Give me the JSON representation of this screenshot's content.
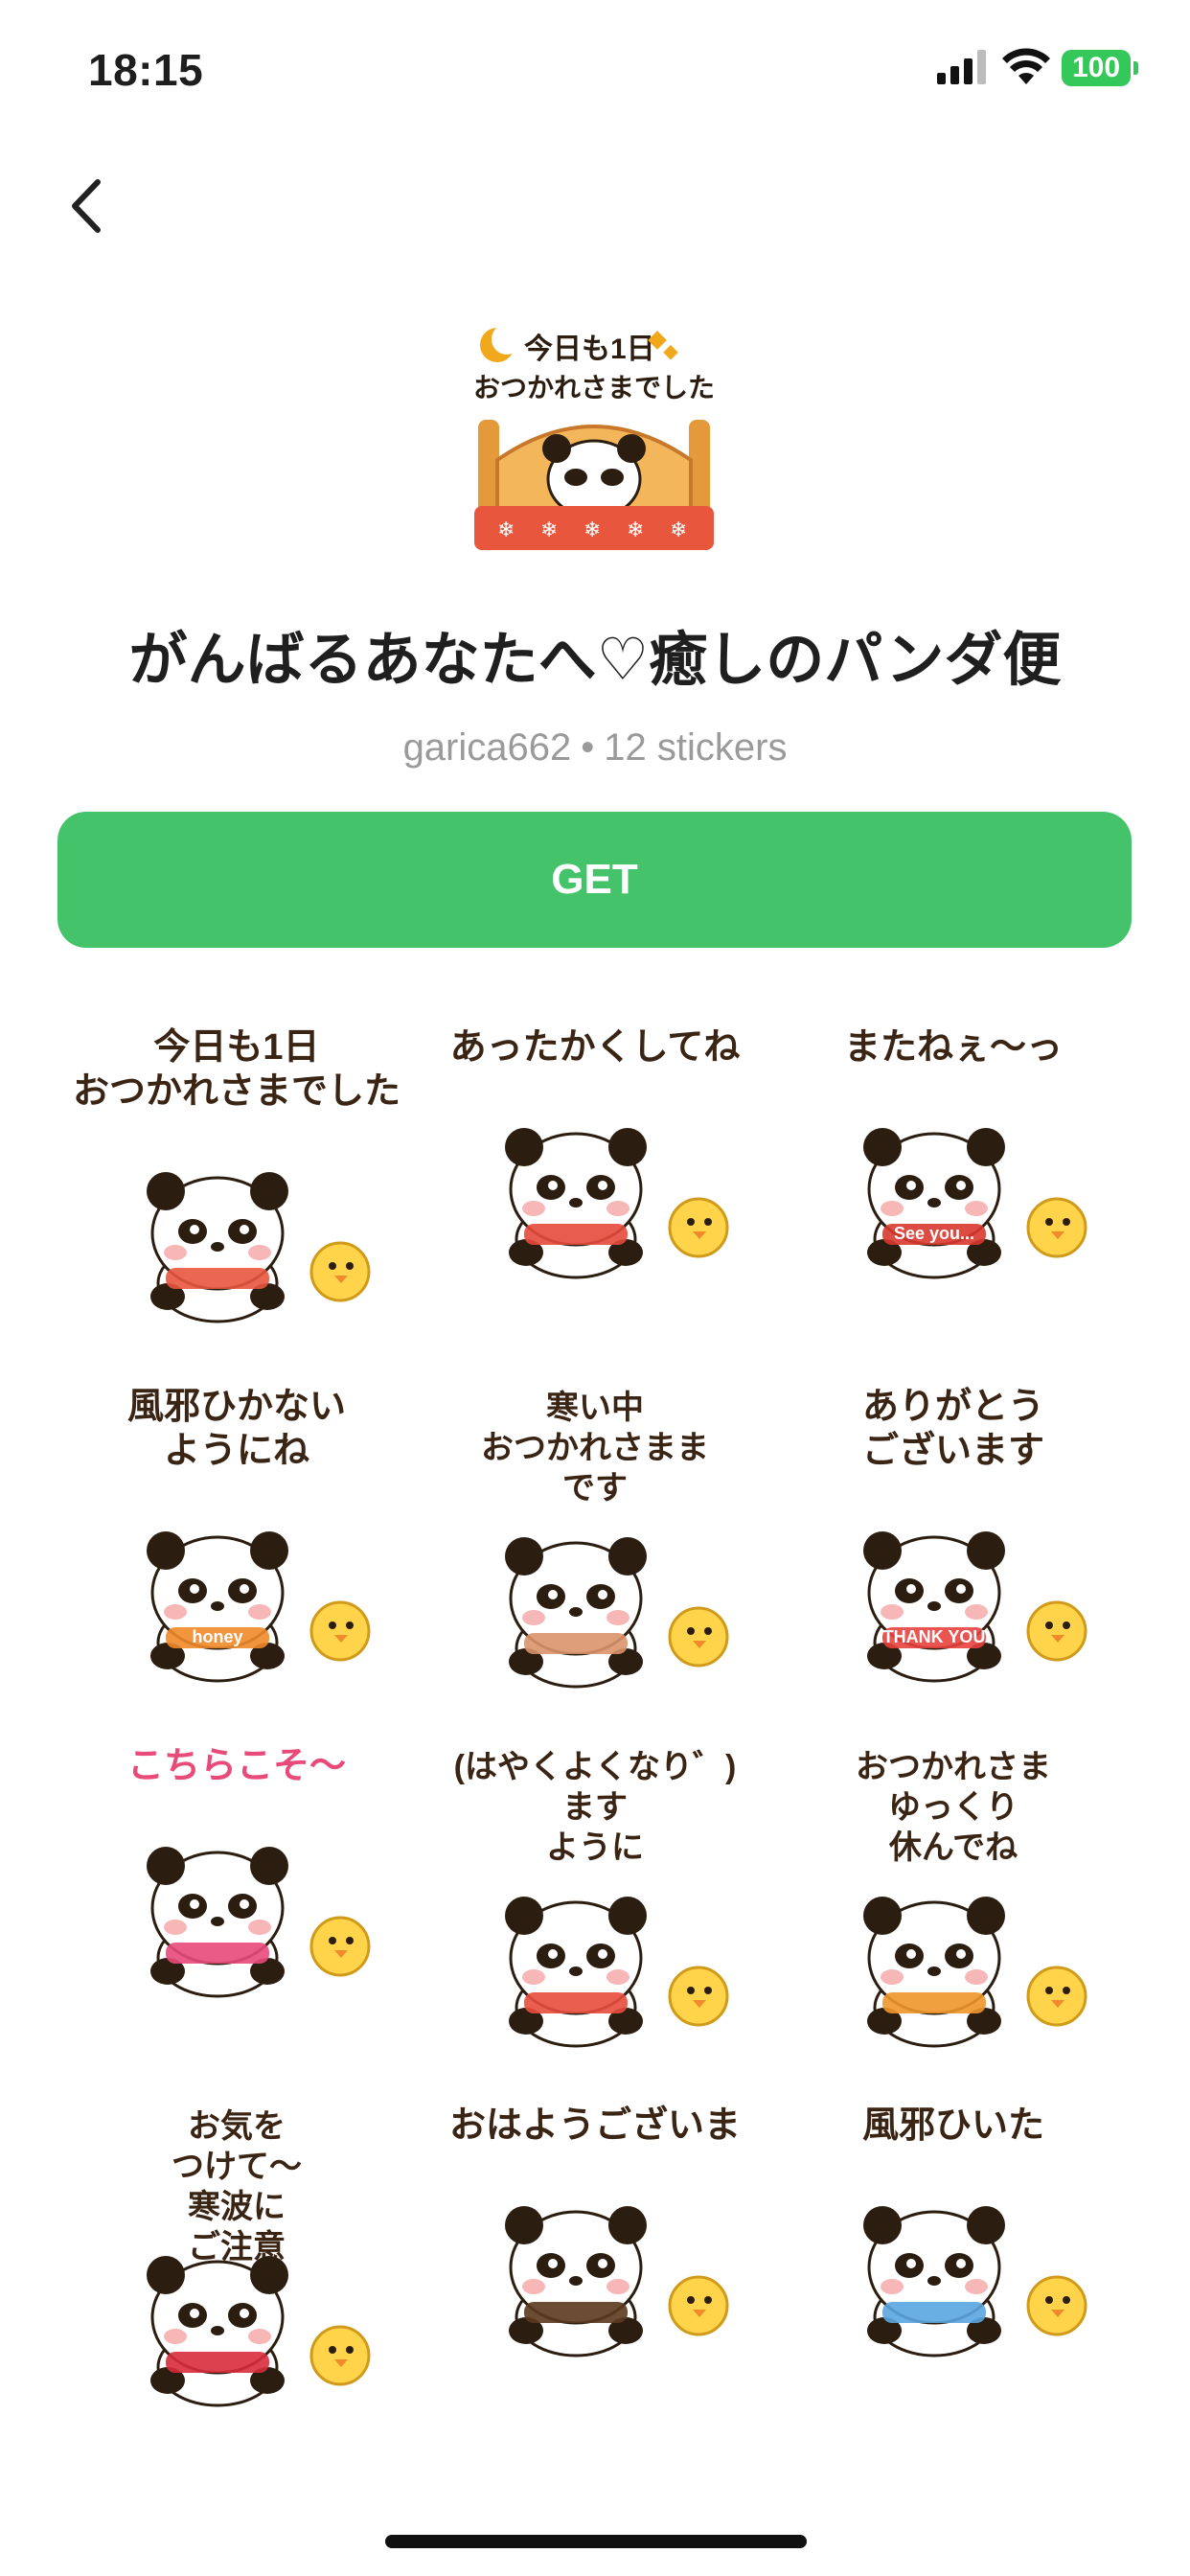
{
  "status_bar": {
    "time": "18:15",
    "battery": "100"
  },
  "pack": {
    "title": "がんばるあなたへ♡癒しのパンダ便",
    "author": "garica662",
    "separator": "•",
    "count": "12 stickers",
    "get_label": "GET"
  },
  "stickers": [
    {
      "text": [
        "今日も1日",
        "おつかれさまでした"
      ],
      "scene": "bed",
      "accent": "#e8563e"
    },
    {
      "text": [
        "あったかくしてね"
      ],
      "scene": "yarn",
      "accent": "#e64a3c"
    },
    {
      "text": [
        "またねぇ〜っ"
      ],
      "scene": "sleigh",
      "accent": "#d8382f",
      "sub": "See you..."
    },
    {
      "text": [
        "風邪ひかない",
        "ようにね"
      ],
      "scene": "honey",
      "accent": "#f08a2a",
      "sub": "honey"
    },
    {
      "text": [
        "寒い中",
        "おつかれさまま",
        "です"
      ],
      "scene": "tea",
      "accent": "#d9946a"
    },
    {
      "text": [
        "ありがとう",
        "ございます"
      ],
      "scene": "thanks",
      "accent": "#e8413e",
      "sub": "THANK YOU"
    },
    {
      "text": [
        "こちらこそ〜"
      ],
      "scene": "hat",
      "accent": "#e84a7a"
    },
    {
      "text": [
        "(はやくよくなり゛)",
        "ます",
        "ように"
      ],
      "scene": "nurse",
      "accent": "#e84c3d"
    },
    {
      "text": [
        "おつかれさま",
        "ゆっくり",
        "休んでね"
      ],
      "scene": "bath",
      "accent": "#f0962a"
    },
    {
      "text": [
        "お気を",
        "つけて〜",
        "寒波に",
        "ご注意"
      ],
      "scene": "tv",
      "accent": "#d82c3c"
    },
    {
      "text": [
        "おはようございま"
      ],
      "scene": "coffee",
      "accent": "#5b3a1e"
    },
    {
      "text": [
        "風邪ひいた"
      ],
      "scene": "sick",
      "accent": "#5aa6e0"
    }
  ]
}
